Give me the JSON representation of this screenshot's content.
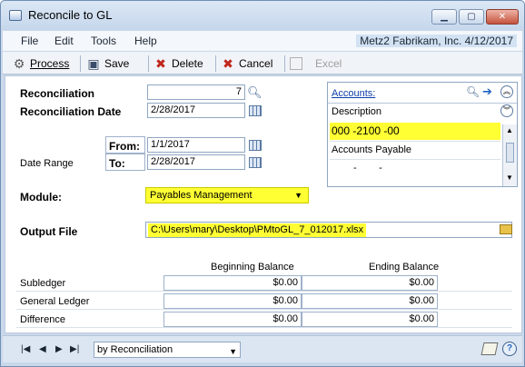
{
  "window": {
    "title": "Reconcile to GL"
  },
  "menu": {
    "items": [
      "File",
      "Edit",
      "Tools",
      "Help"
    ],
    "company": "Metz2  Fabrikam, Inc.  4/12/2017"
  },
  "toolbar": {
    "process": "Process",
    "save": "Save",
    "delete": "Delete",
    "cancel": "Cancel",
    "excel": "Excel"
  },
  "form": {
    "reconciliation_label": "Reconciliation",
    "reconciliation_value": "7",
    "reconciliation_date_label": "Reconciliation Date",
    "reconciliation_date_value": "2/28/2017",
    "date_range_label": "Date Range",
    "from_label": "From:",
    "from_value": "1/1/2017",
    "to_label": "To:",
    "to_value": "2/28/2017",
    "module_label": "Module:",
    "module_value": "Payables Management",
    "output_file_label": "Output File",
    "output_file_value": "C:\\Users\\mary\\Desktop\\PMtoGL_7_012017.xlsx"
  },
  "accounts": {
    "link_label": "Accounts:",
    "column_header": "Description",
    "account_number": "000 -2100 -00",
    "account_description": "Accounts Payable",
    "blank_row": "-        -"
  },
  "balances": {
    "beginning_header": "Beginning Balance",
    "ending_header": "Ending Balance",
    "rows": [
      {
        "label": "Subledger",
        "beginning": "$0.00",
        "ending": "$0.00"
      },
      {
        "label": "General Ledger",
        "beginning": "$0.00",
        "ending": "$0.00"
      },
      {
        "label": "Difference",
        "beginning": "$0.00",
        "ending": "$0.00"
      }
    ]
  },
  "footer": {
    "sort_by": "by Reconciliation"
  },
  "colors": {
    "highlight": "#ffff33",
    "link": "#0b3ea8",
    "window_bg": "#c9d8ea"
  }
}
